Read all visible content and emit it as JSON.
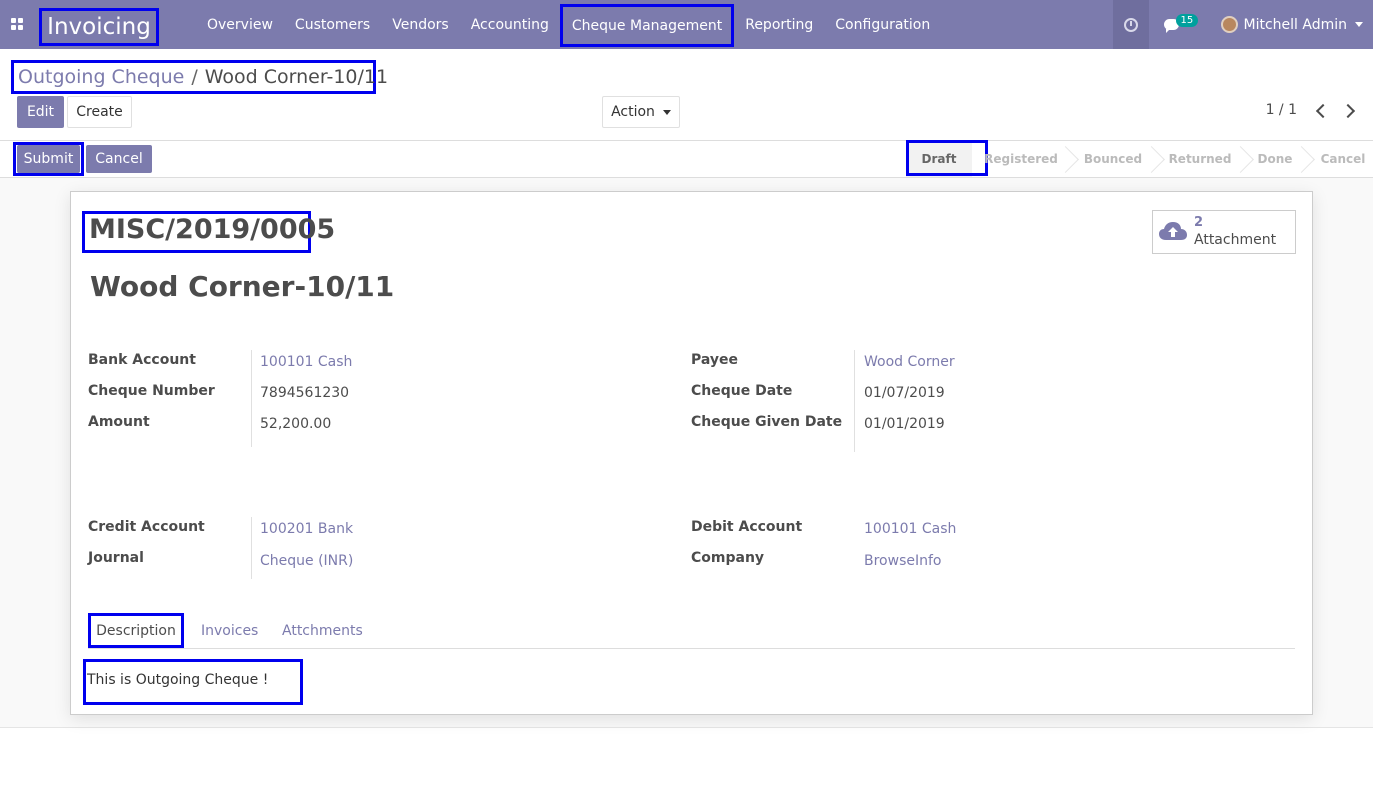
{
  "navbar": {
    "brand": "Invoicing",
    "menu": [
      "Overview",
      "Customers",
      "Vendors",
      "Accounting",
      "Cheque Management",
      "Reporting",
      "Configuration"
    ],
    "message_count": "15",
    "user_name": "Mitchell Admin"
  },
  "breadcrumb": {
    "parent": "Outgoing Cheque",
    "separator": "/",
    "current": "Wood Corner-10/11"
  },
  "control": {
    "edit_label": "Edit",
    "create_label": "Create",
    "action_label": "Action",
    "pager": "1 / 1"
  },
  "statusbar": {
    "submit_label": "Submit",
    "cancel_label": "Cancel",
    "stages": [
      "Draft",
      "Registered",
      "Bounced",
      "Returned",
      "Done",
      "Cancel"
    ],
    "active_stage": "Draft"
  },
  "record": {
    "reference": "MISC/2019/0005",
    "title": "Wood Corner-10/11",
    "attachment_count": "2",
    "attachment_label": "Attachment",
    "fields_left": [
      {
        "label": "Bank Account",
        "value": "100101 Cash"
      },
      {
        "label": "Cheque Number",
        "value": "7894561230"
      },
      {
        "label": "Amount",
        "value": "52,200.00"
      }
    ],
    "fields_right": [
      {
        "label": "Payee",
        "value": "Wood Corner"
      },
      {
        "label": "Cheque Date",
        "value": "01/07/2019"
      },
      {
        "label": "Cheque Given Date",
        "value": "01/01/2019"
      }
    ],
    "accounts_left": [
      {
        "label": "Credit Account",
        "value": "100201 Bank"
      },
      {
        "label": "Journal",
        "value": "Cheque (INR)"
      }
    ],
    "accounts_right": [
      {
        "label": "Debit Account",
        "value": "100101 Cash"
      },
      {
        "label": "Company",
        "value": "BrowseInfo"
      }
    ],
    "tabs": [
      "Description",
      "Invoices",
      "Attchments"
    ],
    "description": "This is Outgoing Cheque !"
  },
  "colors": {
    "primary": "#7c7bad",
    "highlight_box": "#0000ee",
    "badge": "#00a09d"
  }
}
